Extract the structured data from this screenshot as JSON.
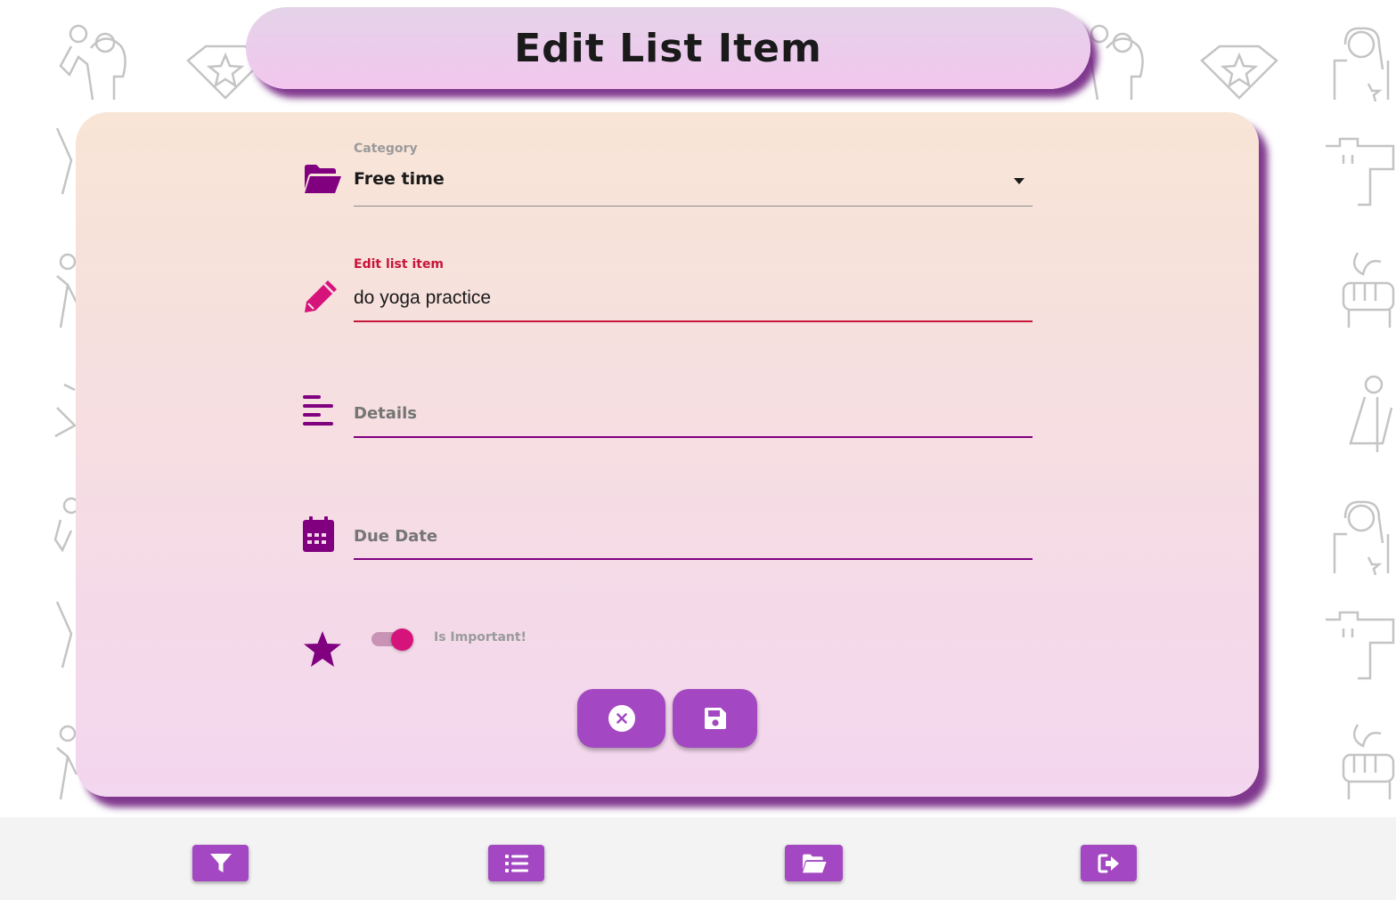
{
  "page": {
    "title": "Edit List Item"
  },
  "form": {
    "category": {
      "label": "Category",
      "value": "Free time",
      "icon": "folder-open-icon"
    },
    "item": {
      "label": "Edit list item",
      "value": "do yoga practice",
      "icon": "pencil-icon"
    },
    "details": {
      "placeholder": "Details",
      "value": "",
      "icon": "align-left-icon"
    },
    "due_date": {
      "placeholder": "Due Date",
      "value": "",
      "icon": "calendar-icon"
    },
    "important": {
      "label": "Is Important!",
      "checked": true,
      "icon": "star-icon"
    }
  },
  "actions": {
    "cancel_icon": "close-circle-icon",
    "save_icon": "floppy-disk-icon"
  },
  "nav": {
    "items": [
      {
        "icon": "filter-icon"
      },
      {
        "icon": "list-icon"
      },
      {
        "icon": "folder-open-icon"
      },
      {
        "icon": "sign-out-icon"
      }
    ]
  },
  "colors": {
    "accent": "#a348c2",
    "icon_purple": "#800080",
    "focus_pink": "#d6137a",
    "label_red": "#c7153a",
    "label_gray": "#9a9a9a"
  }
}
